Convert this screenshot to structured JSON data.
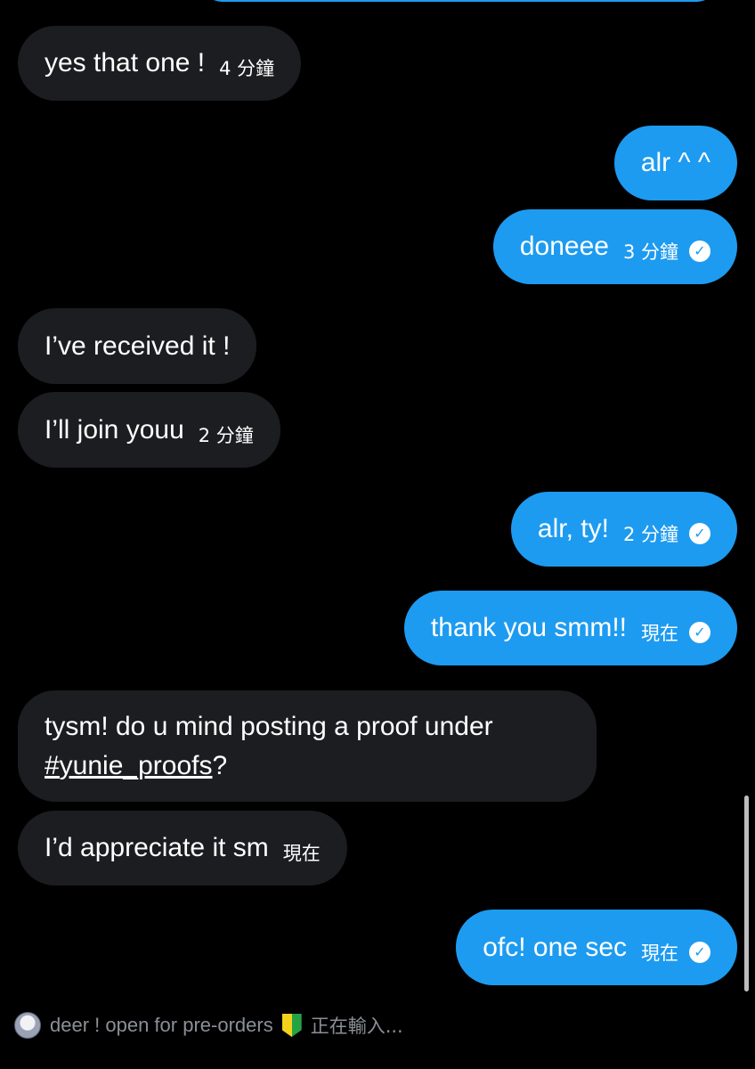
{
  "messages": [
    {
      "side": "received",
      "text": "yes that one !",
      "time": "4 分鐘"
    },
    {
      "side": "sent",
      "text": "alr ^ ^"
    },
    {
      "side": "sent",
      "text": "doneee",
      "time": "3 分鐘",
      "seen": true
    },
    {
      "side": "received",
      "text": "I’ve received it !"
    },
    {
      "side": "received",
      "text": "I’ll join youu",
      "time": "2 分鐘"
    },
    {
      "side": "sent",
      "text": "alr, ty!",
      "time": "2 分鐘",
      "seen": true
    },
    {
      "side": "sent",
      "text": "thank you smm!!",
      "time": "現在",
      "seen": true
    },
    {
      "side": "received",
      "text_line1": "tysm! do u mind posting a proof under",
      "hashtag": "#yunie_proofs",
      "text_after_hashtag": "?"
    },
    {
      "side": "received",
      "text": "I’d appreciate it sm",
      "time": "現在"
    },
    {
      "side": "sent",
      "text": "ofc! one sec",
      "time": "現在",
      "seen": true
    }
  ],
  "typing_indicator": {
    "name": "deer ! open for pre-orders",
    "status": "正在輸入..."
  },
  "icons": {
    "seen_check": "✓",
    "name_badge": "beginner-mark-icon"
  },
  "colors": {
    "background": "#000000",
    "sent_bubble": "#1d9bf0",
    "received_bubble": "#1c1d20",
    "muted_text": "#8b8f96"
  }
}
